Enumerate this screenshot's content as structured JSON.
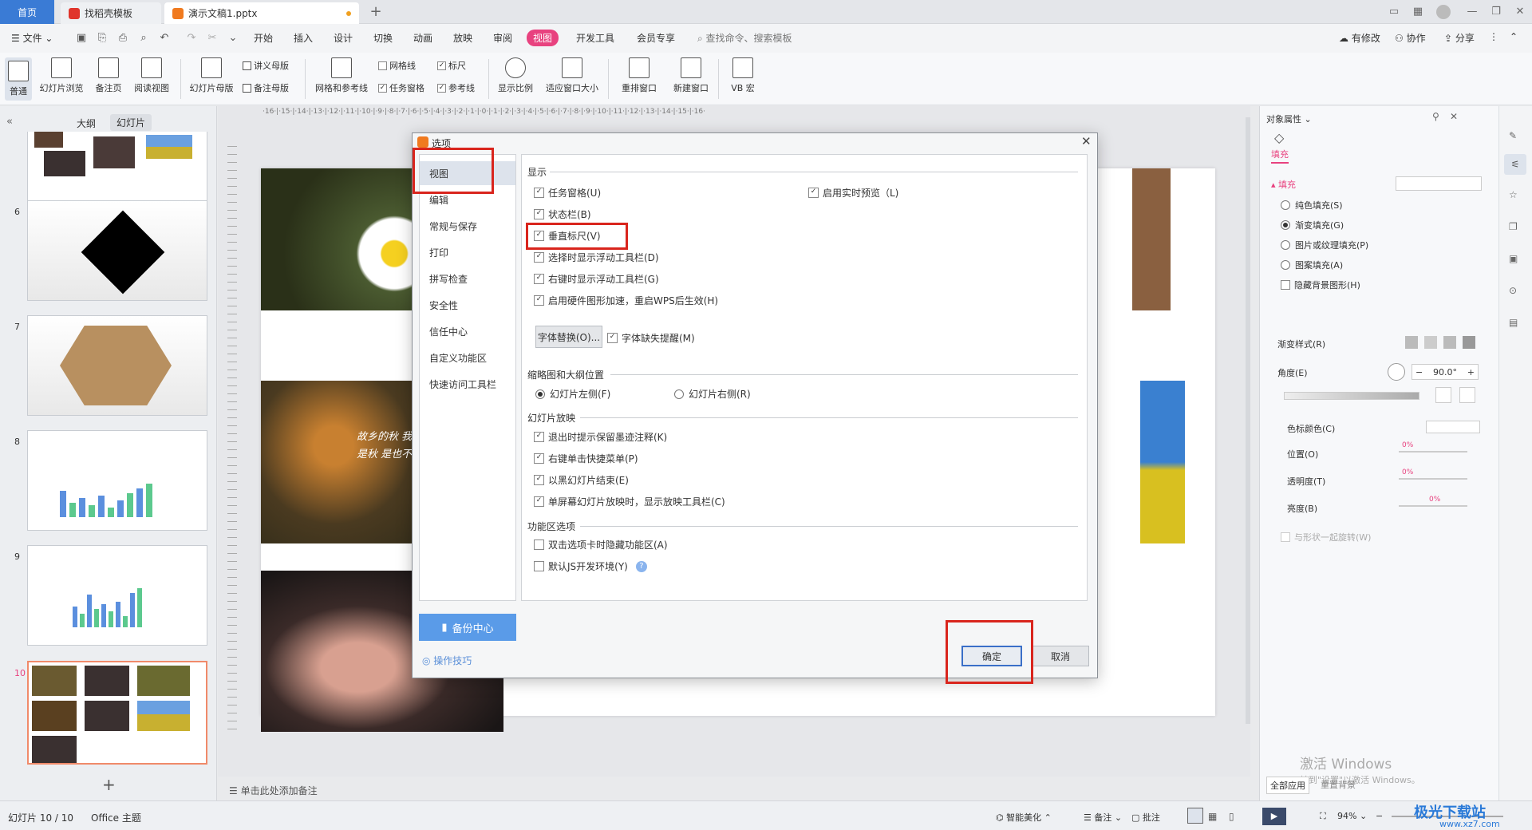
{
  "titlebar": {
    "home_tab": "首页",
    "tab2": "找稻壳模板",
    "tab3": "演示文稿1.pptx",
    "add_tab": "+"
  },
  "menubar": {
    "file": "文件",
    "items": [
      "开始",
      "插入",
      "设计",
      "切换",
      "动画",
      "放映",
      "审阅",
      "视图",
      "开发工具",
      "会员专享"
    ],
    "search": "查找命令、搜索模板",
    "right": [
      "有修改",
      "协作",
      "分享"
    ]
  },
  "ribbon": {
    "big": [
      "普通",
      "幻灯片浏览",
      "备注页",
      "阅读视图",
      "幻灯片母版",
      "网格和参考线",
      "显示比例",
      "适应窗口大小",
      "重排窗口",
      "新建窗口",
      "VB 宏"
    ],
    "small": [
      "讲义母版",
      "备注母版",
      "网格线",
      "任务窗格",
      "标尺",
      "参考线"
    ]
  },
  "leftpanel": {
    "tab_outline": "大纲",
    "tab_slides": "幻灯片",
    "slide_numbers": [
      "6",
      "7",
      "8",
      "9",
      "10"
    ],
    "add": "+"
  },
  "canvas": {
    "ruler_h": "·16·|·15·|·14·|·13·|·12·|·11·|·10·|·9·|·8·|·7·|·6·|·5·|·4·|·3·|·2·|·1·|·0·|·1·|·2·|·3·|·4·|·5·|·6·|·7·|·8·|·9·|·10·|·11·|·12·|·13·|·14·|·15·|·16·",
    "slide_text": "故乡的秋 我不是秋 是也不",
    "notes": "单击此处添加备注"
  },
  "dialog": {
    "title": "选项",
    "nav": [
      "视图",
      "编辑",
      "常规与保存",
      "打印",
      "拼写检查",
      "安全性",
      "信任中心",
      "自定义功能区",
      "快速访问工具栏"
    ],
    "backup": "备份中心",
    "tips": "操作技巧",
    "sections": {
      "display": "显示",
      "thumbnail": "缩略图和大纲位置",
      "slideshow": "幻灯片放映",
      "function": "功能区选项"
    },
    "display_options": [
      "任务窗格(U)",
      "状态栏(B)",
      "垂直标尺(V)",
      "选择时显示浮动工具栏(D)",
      "右键时显示浮动工具栏(G)",
      "启用硬件图形加速，重启WPS后生效(H)"
    ],
    "live_preview": "启用实时预览（L)",
    "font_button": "字体替换(O)...",
    "font_missing": "字体缺失提醒(M)",
    "thumb_left": "幻灯片左侧(F)",
    "thumb_right": "幻灯片右侧(R)",
    "slideshow_options": [
      "退出时提示保留墨迹注释(K)",
      "右键单击快捷菜单(P)",
      "以黑幻灯片结束(E)",
      "单屏幕幻灯片放映时，显示放映工具栏(C)"
    ],
    "function_options": [
      "双击选项卡时隐藏功能区(A)",
      "默认JS开发环境(Y)"
    ],
    "ok": "确定",
    "cancel": "取消"
  },
  "rightpanel": {
    "title": "对象属性",
    "fill_tab": "填充",
    "fill_section": "填充",
    "fill_types": [
      "纯色填充(S)",
      "渐变填充(G)",
      "图片或纹理填充(P)",
      "图案填充(A)",
      "隐藏背景图形(H)"
    ],
    "gradient_style": "渐变样式(R)",
    "angle": "角度(E)",
    "angle_value": "90.0°",
    "stop_color": "色标颜色(C)",
    "position": "位置(O)",
    "transparency": "透明度(T)",
    "brightness": "亮度(B)",
    "pct": "0%",
    "rotate_with_shape": "与形状一起旋转(W)",
    "apply_all": "全部应用",
    "reset": "重置背景",
    "watermark1": "激活 Windows",
    "watermark2": "转到\"设置\"以激活 Windows。"
  },
  "statusbar": {
    "slide": "幻灯片 10 / 10",
    "theme": "Office 主题",
    "beautify": "智能美化",
    "notes": "备注",
    "comments": "批注",
    "zoom": "94%",
    "brand": "极光下载站",
    "brand_url": "www.xz7.com"
  },
  "colors": {
    "accent": "#e8427f",
    "blue": "#3a7bd5",
    "highlight": "#d9251d"
  }
}
